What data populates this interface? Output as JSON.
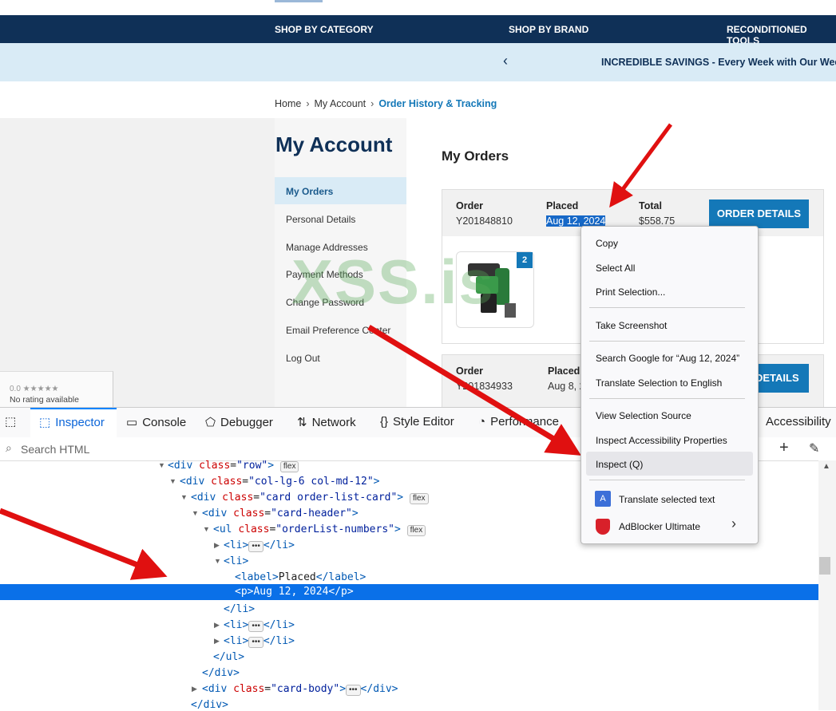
{
  "nav": {
    "items": [
      "SHOP BY CATEGORY",
      "SHOP BY BRAND",
      "RECONDITIONED TOOLS"
    ]
  },
  "promo": {
    "text": "INCREDIBLE SAVINGS - Every Week with Our Wee"
  },
  "breadcrumb": {
    "home": "Home",
    "account": "My Account",
    "current": "Order History & Tracking"
  },
  "sidebar": {
    "title": "My Account",
    "items": [
      "My Orders",
      "Personal Details",
      "Manage Addresses",
      "Payment Methods",
      "Change Password",
      "Email Preference Center",
      "Log Out"
    ]
  },
  "orders": {
    "heading": "My Orders",
    "list": [
      {
        "order_label": "Order",
        "order_no": "Y201848810",
        "placed_label": "Placed",
        "placed": "Aug 12, 2024",
        "total_label": "Total",
        "total": "$558.75",
        "button": "ORDER DETAILS",
        "badge": "2"
      },
      {
        "order_label": "Order",
        "order_no": "Y201834933",
        "placed_label": "Placed",
        "placed": "Aug 8, 2",
        "button": "DETAILS"
      }
    ]
  },
  "rating": {
    "stars": "0.0 ★★★★★",
    "text": "No rating available"
  },
  "watermark": "XSS.is",
  "devtools": {
    "tabs": [
      "Inspector",
      "Console",
      "Debugger",
      "Network",
      "Style Editor",
      "Performance",
      "Accessibility"
    ],
    "search_placeholder": "Search HTML",
    "flex_pill": "flex",
    "dots": "•••"
  },
  "context_menu": {
    "items": [
      "Copy",
      "Select All",
      "Print Selection...",
      "Take Screenshot",
      "Search Google for “Aug 12, 2024”",
      "Translate Selection to English",
      "View Selection Source",
      "Inspect Accessibility Properties",
      "Inspect (Q)",
      "Translate selected text",
      "AdBlocker Ultimate"
    ]
  },
  "colors": {
    "nav": "#0f3057",
    "accent": "#1478b8",
    "highlight": "#0a70e8"
  }
}
